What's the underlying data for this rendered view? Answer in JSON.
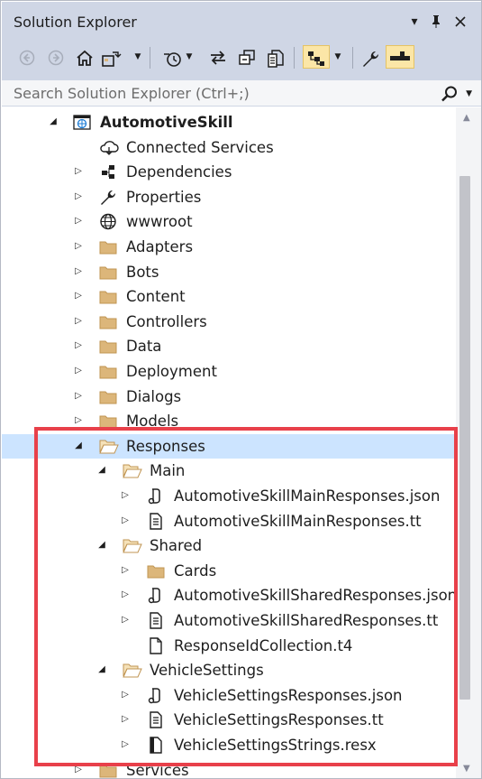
{
  "window": {
    "title": "Solution Explorer",
    "controls": [
      "chevron-down-icon",
      "pin-icon",
      "close-icon"
    ]
  },
  "toolbar": {
    "buttons": [
      "back-icon",
      "forward-icon",
      "home-icon",
      "switch-views-icon",
      "pending-changes-icon",
      "sync-icon",
      "collapse-all-icon",
      "show-all-files-icon",
      "tree-view-icon",
      "properties-icon",
      "preview-icon"
    ]
  },
  "search": {
    "placeholder": "Search Solution Explorer (Ctrl+;)"
  },
  "tree": {
    "items": [
      {
        "label": "AutomotiveSkill",
        "icon": "web-project-icon",
        "expanded": true,
        "bold": true
      },
      {
        "label": "Connected Services",
        "icon": "cloud-icon"
      },
      {
        "label": "Dependencies",
        "icon": "dependencies-icon",
        "expandable": true
      },
      {
        "label": "Properties",
        "icon": "wrench-icon",
        "expandable": true
      },
      {
        "label": "wwwroot",
        "icon": "globe-icon",
        "expandable": true
      },
      {
        "label": "Adapters",
        "icon": "folder-icon",
        "expandable": true
      },
      {
        "label": "Bots",
        "icon": "folder-icon",
        "expandable": true
      },
      {
        "label": "Content",
        "icon": "folder-icon",
        "expandable": true
      },
      {
        "label": "Controllers",
        "icon": "folder-icon",
        "expandable": true
      },
      {
        "label": "Data",
        "icon": "folder-icon",
        "expandable": true
      },
      {
        "label": "Deployment",
        "icon": "folder-icon",
        "expandable": true
      },
      {
        "label": "Dialogs",
        "icon": "folder-icon",
        "expandable": true
      },
      {
        "label": "Models",
        "icon": "folder-icon",
        "expandable": true
      },
      {
        "label": "Responses",
        "icon": "folder-open-icon",
        "expanded": true,
        "selected": true
      },
      {
        "label": "Main",
        "icon": "folder-open-icon",
        "expanded": true
      },
      {
        "label": "AutomotiveSkillMainResponses.json",
        "icon": "json-file-icon",
        "expandable": true
      },
      {
        "label": "AutomotiveSkillMainResponses.tt",
        "icon": "text-file-icon",
        "expandable": true
      },
      {
        "label": "Shared",
        "icon": "folder-open-icon",
        "expanded": true
      },
      {
        "label": "Cards",
        "icon": "folder-icon",
        "expandable": true
      },
      {
        "label": "AutomotiveSkillSharedResponses.json",
        "icon": "json-file-icon",
        "expandable": true
      },
      {
        "label": "AutomotiveSkillSharedResponses.tt",
        "icon": "text-file-icon",
        "expandable": true
      },
      {
        "label": "ResponseIdCollection.t4",
        "icon": "file-icon"
      },
      {
        "label": "VehicleSettings",
        "icon": "folder-open-icon",
        "expanded": true
      },
      {
        "label": "VehicleSettingsResponses.json",
        "icon": "json-file-icon",
        "expandable": true
      },
      {
        "label": "VehicleSettingsResponses.tt",
        "icon": "text-file-icon",
        "expandable": true
      },
      {
        "label": "VehicleSettingsStrings.resx",
        "icon": "resx-file-icon",
        "expandable": true
      },
      {
        "label": "Services",
        "icon": "folder-icon",
        "expandable": true
      }
    ]
  },
  "colors": {
    "chrome": "#cfd6e5",
    "selection": "#cce4ff",
    "highlight_border": "#e8404a",
    "folder": "#dcb67a"
  }
}
